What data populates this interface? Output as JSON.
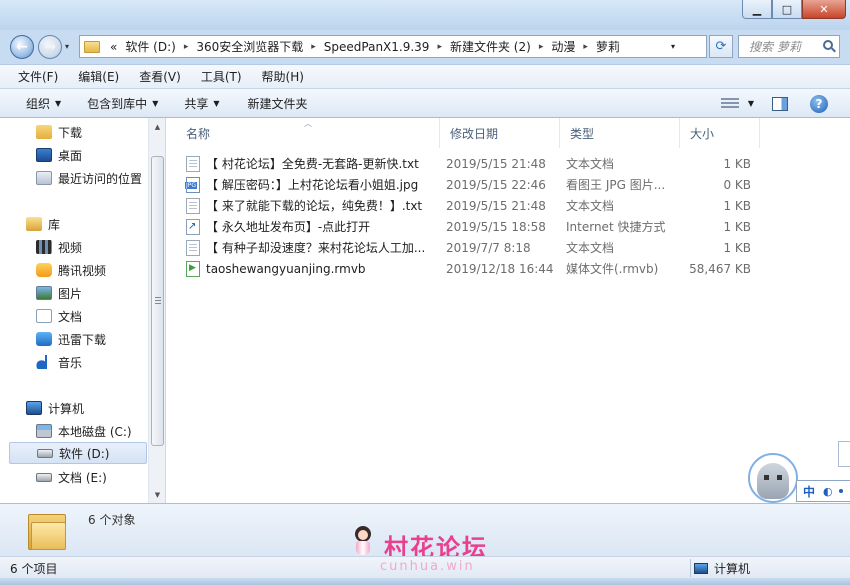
{
  "window": {
    "min_label": "▁",
    "max_label": "□",
    "close_label": "✕"
  },
  "address": {
    "overflow": "«",
    "crumbs": [
      "软件 (D:)",
      "360安全浏览器下载",
      "SpeedPanX1.9.39",
      "新建文件夹 (2)",
      "动漫",
      "萝莉"
    ],
    "separator": "▸",
    "dropdown_glyph": "▾",
    "refresh_glyph": "⟳"
  },
  "search": {
    "placeholder": "搜索 萝莉"
  },
  "menu": [
    "文件(F)",
    "编辑(E)",
    "查看(V)",
    "工具(T)",
    "帮助(H)"
  ],
  "commands": {
    "organize": "组织",
    "include_library": "包含到库中",
    "share": "共享",
    "new_folder": "新建文件夹",
    "help_glyph": "?"
  },
  "nav": {
    "favorites": [
      {
        "label": "下载",
        "icon": "downloads-folder-icon"
      },
      {
        "label": "桌面",
        "icon": "desktop-icon"
      },
      {
        "label": "最近访问的位置",
        "icon": "recent-places-icon"
      }
    ],
    "libraries_label": "库",
    "libraries": [
      {
        "label": "视频",
        "icon": "video-library-icon"
      },
      {
        "label": "腾讯视频",
        "icon": "tencent-video-icon"
      },
      {
        "label": "图片",
        "icon": "pictures-library-icon"
      },
      {
        "label": "文档",
        "icon": "documents-library-icon"
      },
      {
        "label": "迅雷下载",
        "icon": "xunlei-icon"
      },
      {
        "label": "音乐",
        "icon": "music-library-icon"
      }
    ],
    "computer_label": "计算机",
    "drives": [
      {
        "label": "本地磁盘 (C:)",
        "icon": "local-disk-icon"
      },
      {
        "label": "软件 (D:)",
        "icon": "drive-icon",
        "selected": true
      },
      {
        "label": "文档 (E:)",
        "icon": "drive-icon"
      }
    ]
  },
  "columns": {
    "name": "名称",
    "date": "修改日期",
    "type": "类型",
    "size": "大小"
  },
  "files": [
    {
      "name": "【 村花论坛】全免费-无套路-更新快.txt",
      "date": "2019/5/15 21:48",
      "type": "文本文档",
      "size": "1 KB",
      "icon": "text-file-icon"
    },
    {
      "name": "【 解压密码：】上村花论坛看小姐姐.jpg",
      "date": "2019/5/15 22:46",
      "type": "看图王 JPG 图片...",
      "size": "0 KB",
      "icon": "jpg-file-icon"
    },
    {
      "name": "【 来了就能下载的论坛，纯免费！】.txt",
      "date": "2019/5/15 21:48",
      "type": "文本文档",
      "size": "1 KB",
      "icon": "text-file-icon"
    },
    {
      "name": "【 永久地址发布页】-点此打开",
      "date": "2019/5/15 18:58",
      "type": "Internet 快捷方式",
      "size": "1 KB",
      "icon": "internet-shortcut-icon"
    },
    {
      "name": "【 有种子却没速度？来村花论坛人工加...",
      "date": "2019/7/7 8:18",
      "type": "文本文档",
      "size": "1 KB",
      "icon": "text-file-icon"
    },
    {
      "name": "taoshewangyuanjing.rmvb",
      "date": "2019/12/18 16:44",
      "type": "媒体文件(.rmvb)",
      "size": "58,467 KB",
      "icon": "media-file-icon"
    }
  ],
  "ime": {
    "mode": "中",
    "moon": "◐"
  },
  "details": {
    "count": "6 个对象"
  },
  "watermark": {
    "text": "村花论坛",
    "sub": "cunhua.win"
  },
  "status": {
    "items": "6 个项目",
    "location": "计算机"
  }
}
